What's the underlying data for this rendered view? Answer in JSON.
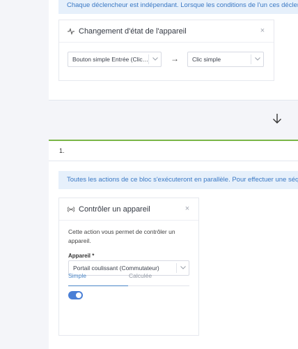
{
  "top_info_text": "Chaque déclencheur est indépendant. Lorsque les conditions de l'un ces déclencheurs sont",
  "trigger_card": {
    "title": "Changement d'état de l'appareil",
    "icon": "pulse-icon",
    "close_label": "×",
    "source_select": "Bouton simple Entrée (Clic…",
    "arrow": "→",
    "target_select": "Clic simple"
  },
  "step": {
    "number": "1."
  },
  "action_info_text": "Toutes les actions de ce bloc s'exécuteront en parallèle. Pour effectuer une séquence d'ac",
  "action_card": {
    "title": "Contrôler un appareil",
    "icon": "broadcast-icon",
    "close_label": "×",
    "description": "Cette action vous permet de contrôler un appareil.",
    "device_label": "Appareil *",
    "device_value": "Portail coulissant (Commutateur)",
    "tabs": [
      "Simple",
      "Calculée"
    ],
    "active_tab": "Simple",
    "toggle_on": true,
    "accent_color": "#4a7fd6"
  },
  "colors": {
    "info_bg": "#e6f0fb",
    "info_text": "#3a78c4",
    "step_line": "#7ab648"
  }
}
